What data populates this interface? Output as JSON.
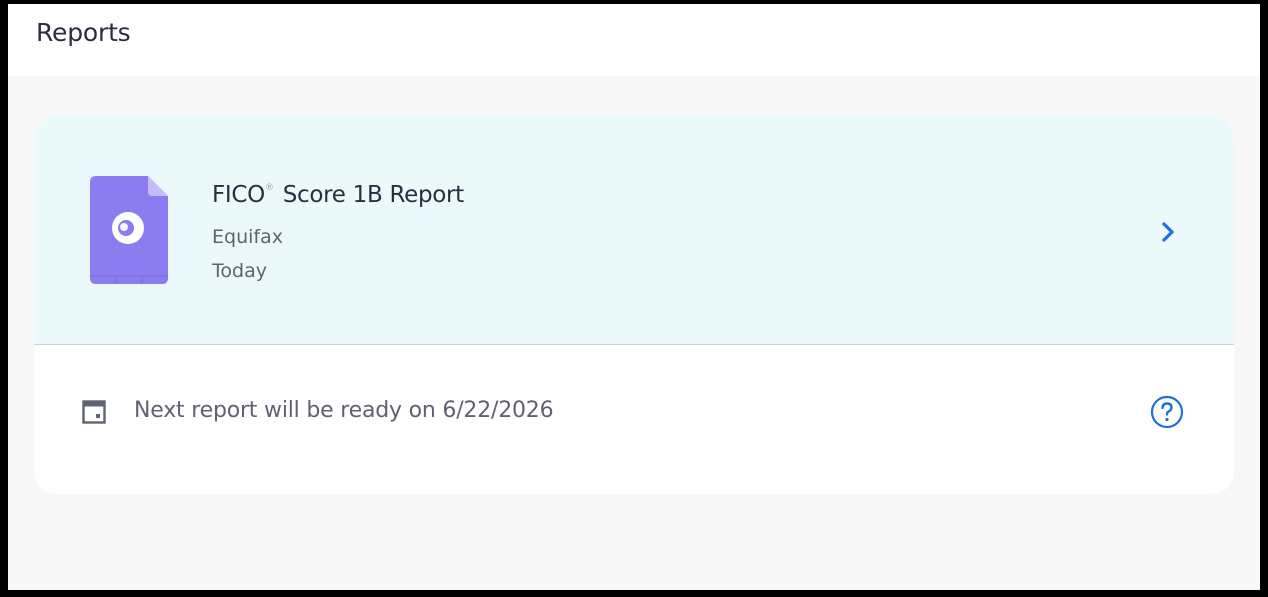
{
  "header": {
    "title": "Reports"
  },
  "report": {
    "title": "FICO",
    "registered_mark": "®",
    "title_rest": "Score 1B Report",
    "bureau": "Equifax",
    "date": "Today",
    "icon": "document-icon",
    "chevron_icon": "chevron-right-icon"
  },
  "next_report": {
    "icon": "calendar-icon",
    "text": "Next report will be ready on 6/22/2026",
    "help_icon": "question-circle-icon"
  },
  "colors": {
    "accent": "#1e6fd9",
    "doc_icon": "#8b7cf0",
    "report_row_bg": "#ecf9fb",
    "page_bg": "#f7f7f7",
    "text_primary": "#2b2d42",
    "text_secondary": "#5f6272"
  }
}
